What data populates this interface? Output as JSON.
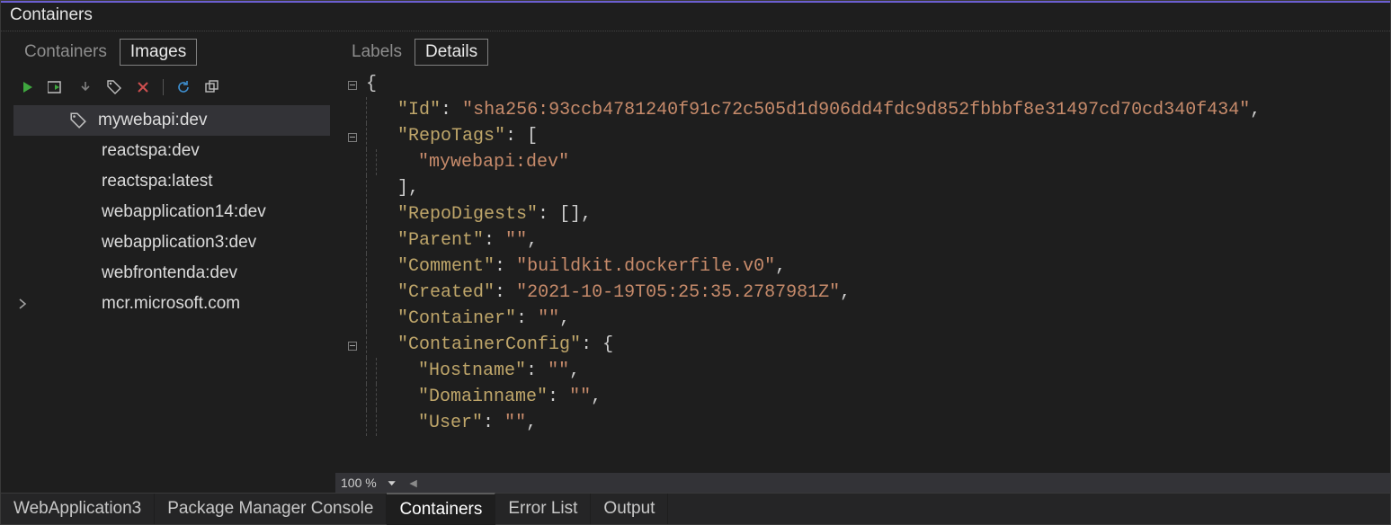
{
  "panelTitle": "Containers",
  "leftTabs": {
    "containers": "Containers",
    "images": "Images",
    "activeIndex": 1
  },
  "rightTabs": {
    "labels": "Labels",
    "details": "Details",
    "activeIndex": 1
  },
  "toolbar": {
    "run": "Run",
    "runWindow": "Run in window",
    "pull": "Pull",
    "tag": "Tag",
    "delete": "Delete",
    "refresh": "Refresh",
    "prune": "Prune"
  },
  "images": {
    "list": [
      {
        "name": "mywebapi:dev",
        "selected": true,
        "tagged": true
      },
      {
        "name": "reactspa:dev",
        "selected": false,
        "tagged": false
      },
      {
        "name": "reactspa:latest",
        "selected": false,
        "tagged": false
      },
      {
        "name": "webapplication14:dev",
        "selected": false,
        "tagged": false
      },
      {
        "name": "webapplication3:dev",
        "selected": false,
        "tagged": false
      },
      {
        "name": "webfrontenda:dev",
        "selected": false,
        "tagged": false
      }
    ],
    "group": {
      "name": "mcr.microsoft.com",
      "expandable": true
    }
  },
  "json": {
    "Id": "sha256:93ccb4781240f91c72c505d1d906dd4fdc9d852fbbbf8e31497cd70cd340f434",
    "RepoTags": [
      "mywebapi:dev"
    ],
    "RepoDigests": [],
    "Parent": "",
    "Comment": "buildkit.dockerfile.v0",
    "Created": "2021-10-19T05:25:35.2787981Z",
    "Container": "",
    "ContainerConfig": {
      "Hostname": "",
      "Domainname": "",
      "User": ""
    }
  },
  "zoom": "100 %",
  "bottomTabs": {
    "items": [
      "WebApplication3",
      "Package Manager Console",
      "Containers",
      "Error List",
      "Output"
    ],
    "activeIndex": 2
  }
}
